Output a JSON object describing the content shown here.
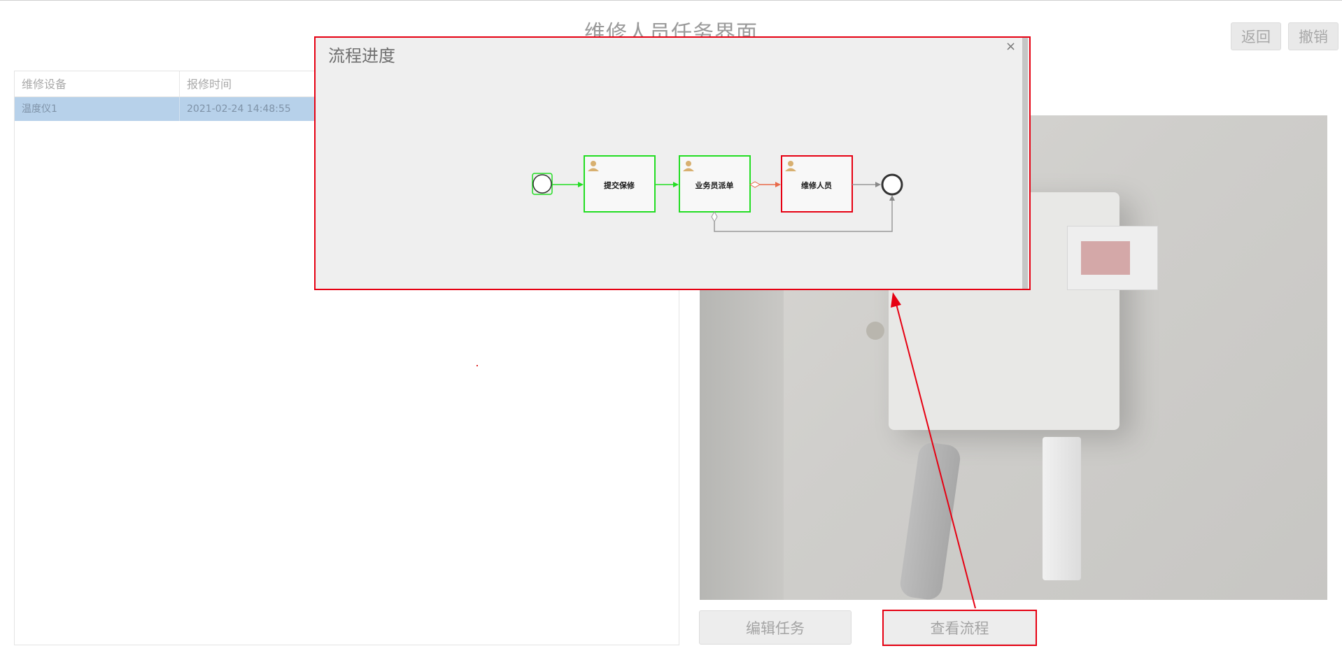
{
  "page": {
    "title": "维修人员任务界面"
  },
  "header_buttons": {
    "back": "返回",
    "revoke": "撤销"
  },
  "table": {
    "columns": [
      "维修设备",
      "报修时间"
    ],
    "rows": [
      {
        "device": "温度仪1",
        "time": "2021-02-24 14:48:55"
      }
    ]
  },
  "bottom_buttons": {
    "edit": "编辑任务",
    "view_flow": "查看流程"
  },
  "modal": {
    "title": "流程进度",
    "close": "×",
    "nodes": [
      {
        "label": "提交保修",
        "state": "done"
      },
      {
        "label": "业务员派单",
        "state": "done"
      },
      {
        "label": "维修人员",
        "state": "current"
      }
    ]
  },
  "colors": {
    "done": "#22dd22",
    "current": "#e60012",
    "annotation": "#e60012"
  },
  "icons": {
    "task": "user-icon",
    "start": "start-event-icon",
    "end": "end-event-icon",
    "close": "close-icon"
  }
}
